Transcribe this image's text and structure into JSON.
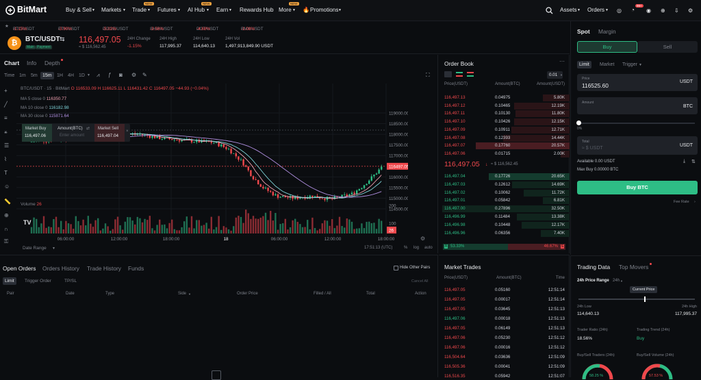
{
  "brand": "BitMart",
  "nav": {
    "items": [
      "Buy & Sell",
      "Markets",
      "Trade",
      "Futures",
      "AI Hub",
      "Earn",
      "Rewards Hub",
      "More",
      "Promotions"
    ],
    "new_tags": [
      "NEW",
      "NEW",
      "NEW",
      "NEW"
    ],
    "assets": "Assets",
    "orders": "Orders",
    "badge": "99+"
  },
  "ticker": [
    {
      "pair": "BTC/USDT",
      "chg": "-1.15%"
    },
    {
      "pair": "ETH/USDT",
      "chg": "-3.90%"
    },
    {
      "pair": "DOGE/USDT",
      "chg": "-5.02%"
    },
    {
      "pair": "SHIB/USDT",
      "chg": "-3.56%"
    },
    {
      "pair": "DOT/USDT",
      "chg": "-4.68%"
    },
    {
      "pair": "BMX/USDT",
      "chg": "-1.08%"
    }
  ],
  "pair": {
    "name": "BTC/USDT",
    "tag1": "Main",
    "tag2": "Payment",
    "price": "116,497.05",
    "price_usd": "≈ $ 116,562.45",
    "stats": [
      {
        "l": "24H Change",
        "v": "-1.15%"
      },
      {
        "l": "24H High",
        "v": "117,995.37"
      },
      {
        "l": "24H Low",
        "v": "114,640.13"
      },
      {
        "l": "24H Vol",
        "v": "1,497,913,849.90 USDT"
      }
    ]
  },
  "chart_tabs": [
    "Chart",
    "Info",
    "Depth"
  ],
  "intervals": [
    "Time",
    "1m",
    "5m",
    "15m",
    "1H",
    "4H",
    "1D"
  ],
  "chart_head": {
    "title": "BTC/USDT · 15 · BitMart",
    "o": "O 116533.09",
    "h": "H 116625.11",
    "l": "L 116431.42",
    "c": "C 116497.05",
    "chg": "−44.93 (−0.04%)",
    "ma5": "MA 5 close 0",
    "ma5v": "116350.77",
    "ma10": "MA 10 close 0",
    "ma10v": "116182.98",
    "ma30": "MA 30 close 0",
    "ma30v": "115871.64"
  },
  "quick": {
    "buy": "Market Buy",
    "buy_v": "116,497.06",
    "amt": "Amount(BTC)",
    "amt_ph": "Enter amount",
    "sell": "Market Sell",
    "sell_v": "116,497.04"
  },
  "price_axis": [
    "119000.00",
    "118500.00",
    "118000.00",
    "117500.00",
    "117000.00",
    "116497.05",
    "116000.00",
    "115500.00",
    "115000.00",
    "114500.00"
  ],
  "vol_axis": [
    "200",
    "100",
    "26"
  ],
  "volume_label": "Volume",
  "volume_val": "26",
  "time_axis": [
    "06:00:00",
    "12:00:00",
    "18:00:00",
    "18",
    "06:00:00",
    "12:00:00",
    "18:00:00"
  ],
  "chart_foot": {
    "range": "Date Range",
    "time": "17:51:13 (UTC)",
    "pct": "%",
    "log": "log",
    "auto": "auto"
  },
  "orders_tabs": [
    "Open Orders",
    "Orders History",
    "Trade History",
    "Funds"
  ],
  "hide_pairs": "Hide Other Pairs",
  "order_subtabs": [
    "Limit",
    "Trigger Order",
    "TP/SL"
  ],
  "cancel_all": "Cancel All",
  "order_cols": [
    "Pair",
    "Date",
    "Type",
    "Side",
    "Order Price",
    "Filled / All",
    "Total",
    "Action"
  ],
  "orderbook": {
    "title": "Order Book",
    "precision": "0.01",
    "cols": [
      "Price(USDT)",
      "Amount(BTC)",
      "Amount(USDT)"
    ],
    "asks": [
      [
        "116,497.13",
        "0.04975",
        "5.80K"
      ],
      [
        "116,497.12",
        "0.10465",
        "12.19K"
      ],
      [
        "116,497.11",
        "0.10130",
        "11.80K"
      ],
      [
        "116,497.10",
        "0.10426",
        "12.15K"
      ],
      [
        "116,497.09",
        "0.10911",
        "12.71K"
      ],
      [
        "116,497.08",
        "0.12393",
        "14.44K"
      ],
      [
        "116,497.07",
        "0.17760",
        "20.57K"
      ],
      [
        "116,497.06",
        "0.01715",
        "2.00K"
      ]
    ],
    "mid": "116,497.05",
    "mid_usd": "≈ $ 116,562.45",
    "bids": [
      [
        "116,497.04",
        "0.17726",
        "20.65K"
      ],
      [
        "116,497.03",
        "0.12612",
        "14.69K"
      ],
      [
        "116,497.02",
        "0.10062",
        "11.72K"
      ],
      [
        "116,497.01",
        "0.05842",
        "6.81K"
      ],
      [
        "116,497.00",
        "0.27896",
        "32.50K"
      ],
      [
        "116,496.99",
        "0.11484",
        "13.38K"
      ],
      [
        "116,496.98",
        "0.10448",
        "12.17K"
      ],
      [
        "116,496.96",
        "0.06356",
        "7.40K"
      ]
    ],
    "buy_pct": "53.33%",
    "sell_pct": "46.67%"
  },
  "trades": {
    "title": "Market Trades",
    "cols": [
      "Price(USDT)",
      "Amount(BTC)",
      "Time"
    ],
    "rows": [
      [
        "116,497.05",
        "0.05160",
        "12:51:14",
        "r"
      ],
      [
        "116,497.05",
        "0.00017",
        "12:51:14",
        "r"
      ],
      [
        "116,497.05",
        "0.03645",
        "12:51:13",
        "r"
      ],
      [
        "116,497.06",
        "0.00018",
        "12:51:13",
        "g"
      ],
      [
        "116,497.05",
        "0.06149",
        "12:51:13",
        "r"
      ],
      [
        "116,497.06",
        "0.05230",
        "12:51:12",
        "r"
      ],
      [
        "116,497.06",
        "0.00016",
        "12:51:12",
        "r"
      ],
      [
        "116,504.64",
        "0.03636",
        "12:51:09",
        "r"
      ],
      [
        "116,505.36",
        "0.00041",
        "12:51:09",
        "r"
      ],
      [
        "116,516.35",
        "0.05942",
        "12:51:07",
        "r"
      ]
    ]
  },
  "trade_form": {
    "tabs": [
      "Spot",
      "Margin"
    ],
    "buy": "Buy",
    "sell": "Sell",
    "types": [
      "Limit",
      "Market",
      "Trigger"
    ],
    "price_label": "Price",
    "price": "116525.60",
    "unit": "USDT",
    "amount_label": "Amount",
    "amount_unit": "BTC",
    "pct": "0%",
    "total_label": "Total",
    "total_ph": "≈ $ USDT",
    "total_unit": "USDT",
    "available": "Available 0.00 USDT",
    "max_buy": "Max Buy 0.00000 BTC",
    "buy_btn": "Buy BTC",
    "fee": "Fee Rate"
  },
  "trading_data": {
    "tabs": [
      "Trading Data",
      "Top Movers"
    ],
    "range_l": "24h Price Range",
    "range_v": "24h",
    "current": "Current Price",
    "low_l": "24h Low",
    "low": "114,640.13",
    "high_l": "24h High",
    "high": "117,995.37",
    "ratio_l": "Trader Ratio (24h)",
    "ratio": "18.56%",
    "trend_l": "Trading Trend (24h)",
    "trend": "Buy",
    "bs_traders": "Buy/Sell Traders (24h)",
    "bs_vol": "Buy/Sell Volume (24h)",
    "g1": "58.25 %",
    "g2": "57.53 %"
  },
  "colors": {
    "red": "#f0484c",
    "green": "#2ebd85",
    "accent": "#f6a540"
  }
}
